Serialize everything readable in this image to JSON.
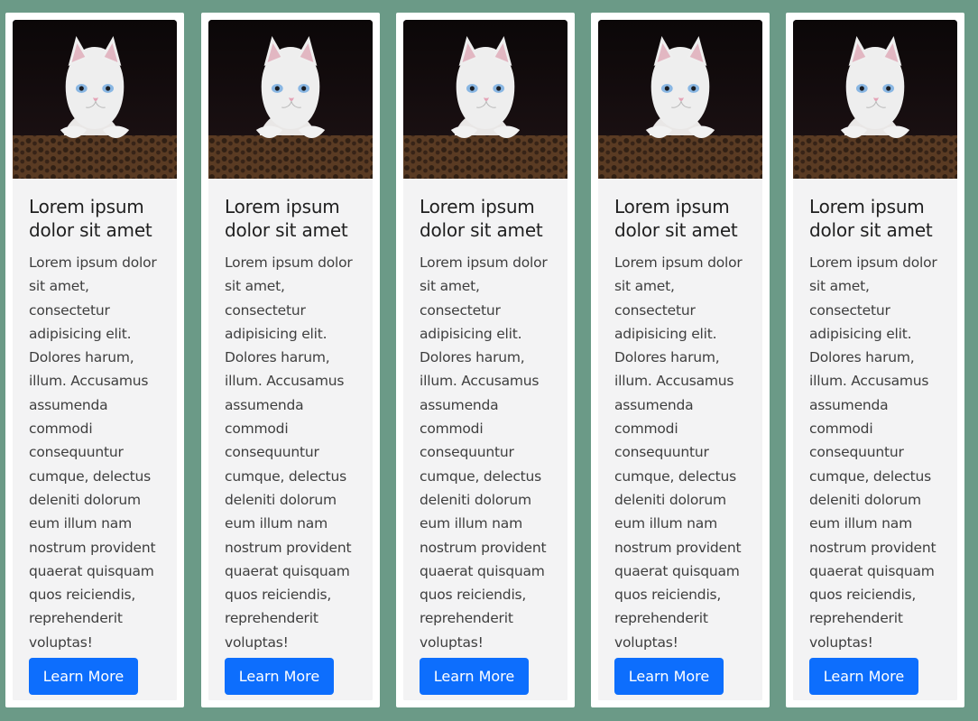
{
  "cards": [
    {
      "title": "Lorem ipsum dolor sit amet",
      "text": "Lorem ipsum dolor sit amet, consectetur adipisicing elit. Dolores harum, illum. Accusamus assumenda commodi consequuntur cumque, delectus deleniti dolorum eum illum nam nostrum provident quaerat quisquam quos reiciendis, reprehenderit voluptas!",
      "button_label": "Learn More"
    },
    {
      "title": "Lorem ipsum dolor sit amet",
      "text": "Lorem ipsum dolor sit amet, consectetur adipisicing elit. Dolores harum, illum. Accusamus assumenda commodi consequuntur cumque, delectus deleniti dolorum eum illum nam nostrum provident quaerat quisquam quos reiciendis, reprehenderit voluptas!",
      "button_label": "Learn More"
    },
    {
      "title": "Lorem ipsum dolor sit amet",
      "text": "Lorem ipsum dolor sit amet, consectetur adipisicing elit. Dolores harum, illum. Accusamus assumenda commodi consequuntur cumque, delectus deleniti dolorum eum illum nam nostrum provident quaerat quisquam quos reiciendis, reprehenderit voluptas!",
      "button_label": "Learn More"
    },
    {
      "title": "Lorem ipsum dolor sit amet",
      "text": "Lorem ipsum dolor sit amet, consectetur adipisicing elit. Dolores harum, illum. Accusamus assumenda commodi consequuntur cumque, delectus deleniti dolorum eum illum nam nostrum provident quaerat quisquam quos reiciendis, reprehenderit voluptas!",
      "button_label": "Learn More"
    },
    {
      "title": "Lorem ipsum dolor sit amet",
      "text": "Lorem ipsum dolor sit amet, consectetur adipisicing elit. Dolores harum, illum. Accusamus assumenda commodi consequuntur cumque, delectus deleniti dolorum eum illum nam nostrum provident quaerat quisquam quos reiciendis, reprehenderit voluptas!",
      "button_label": "Learn More"
    }
  ],
  "colors": {
    "background": "#6b9a87",
    "card_border": "#ffffff",
    "card_body": "#f3f3f4",
    "button": "#0d6efd",
    "button_text": "#ffffff",
    "title_text": "#1f1f1f",
    "body_text": "#3e3e3e"
  }
}
